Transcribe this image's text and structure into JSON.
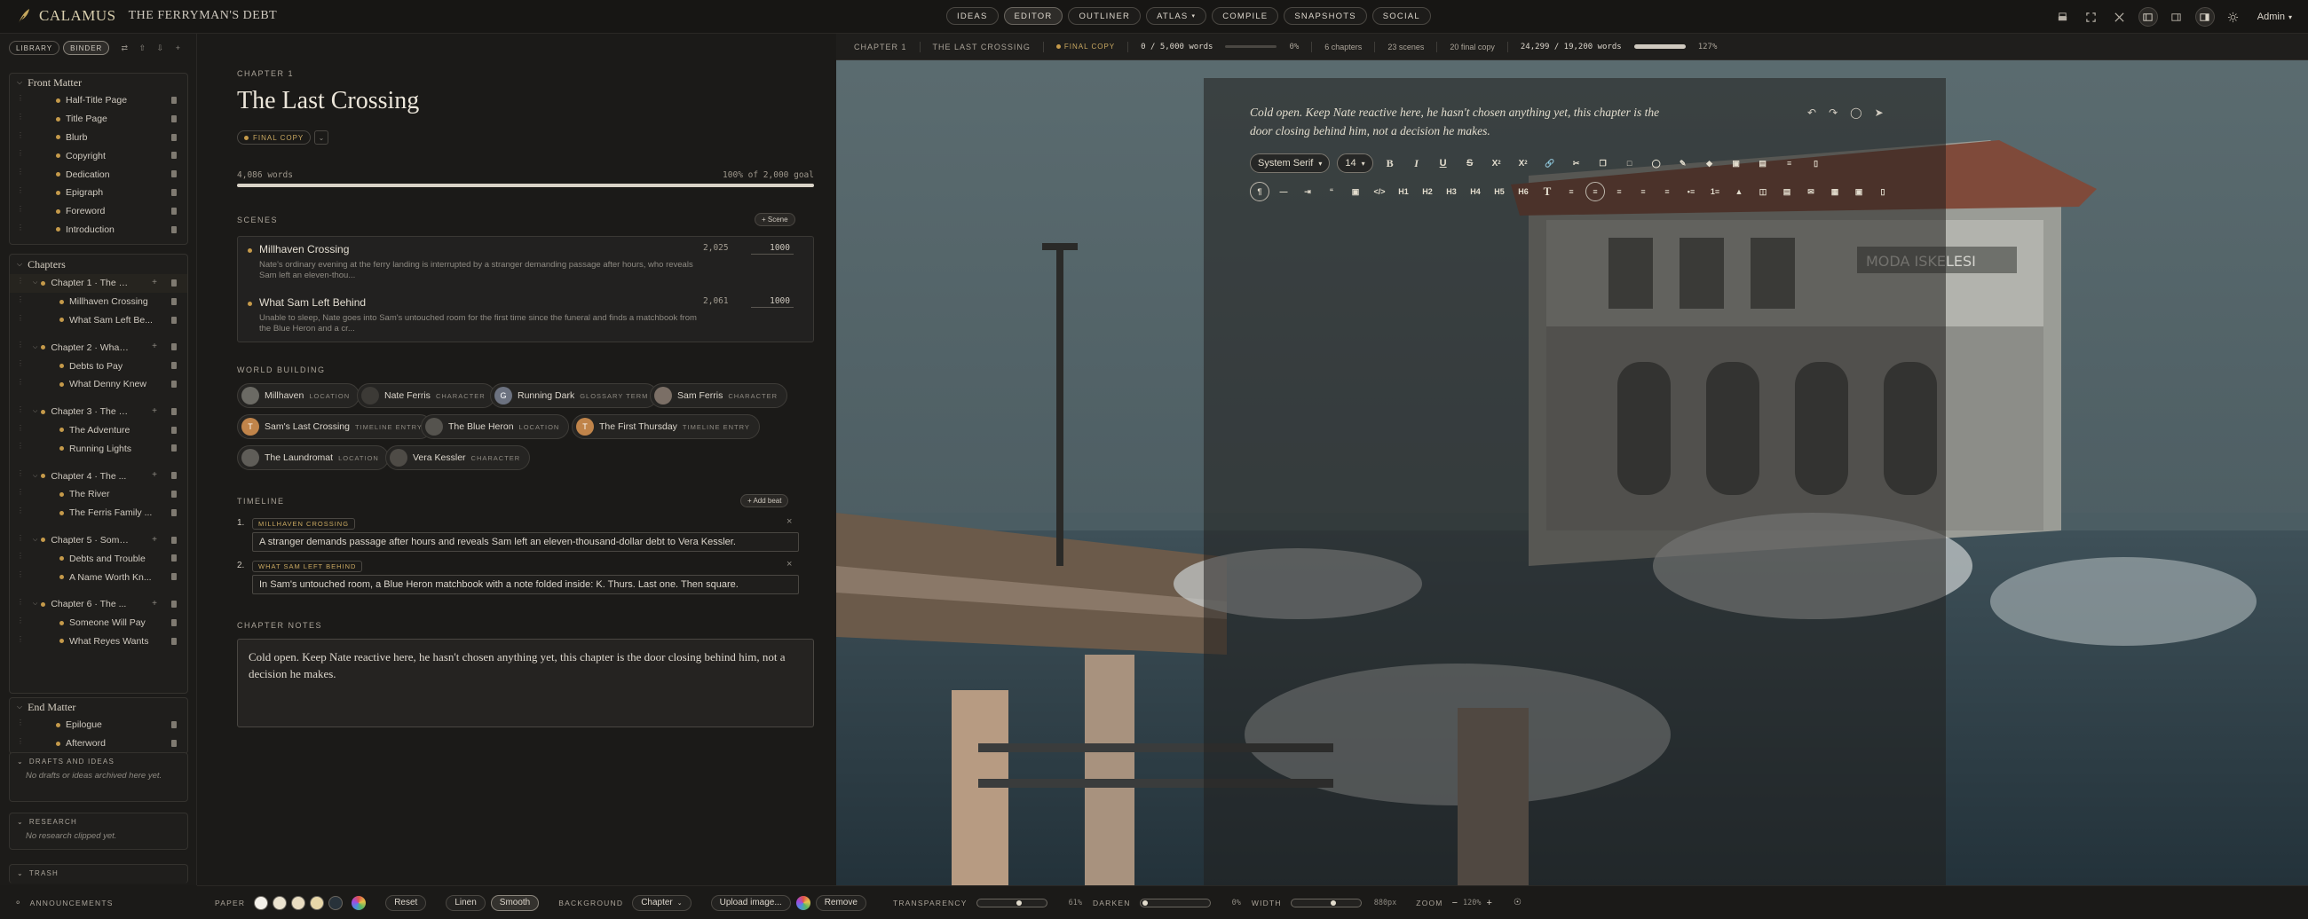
{
  "app": {
    "brand": "CALAMUS",
    "project_title": "THE FERRYMAN'S DEBT"
  },
  "nav": {
    "items": [
      "IDEAS",
      "EDITOR",
      "OUTLINER",
      "ATLAS",
      "COMPILE",
      "SNAPSHOTS",
      "SOCIAL"
    ],
    "active": "EDITOR",
    "user": "Admin"
  },
  "sidebar": {
    "tabs": [
      "LIBRARY",
      "BINDER"
    ],
    "active_tab": "BINDER",
    "front_matter": {
      "title": "Front Matter",
      "items": [
        "Half-Title Page",
        "Title Page",
        "Blurb",
        "Copyright",
        "Dedication",
        "Epigraph",
        "Foreword",
        "Introduction"
      ]
    },
    "chapters": {
      "title": "Chapters",
      "items": [
        {
          "label": "Chapter 1 · The L...",
          "scenes": [
            "Millhaven Crossing",
            "What Sam Left Be..."
          ]
        },
        {
          "label": "Chapter 2 · What...",
          "scenes": [
            "Debts to Pay",
            "What Denny Knew"
          ]
        },
        {
          "label": "Chapter 3 · The F...",
          "scenes": [
            "The Adventure",
            "Running Lights"
          ]
        },
        {
          "label": "Chapter 4 · The ...",
          "scenes": [
            "The River",
            "The Ferris Family ..."
          ]
        },
        {
          "label": "Chapter 5 · Some...",
          "scenes": [
            "Debts and Trouble",
            "A Name Worth Kn..."
          ]
        },
        {
          "label": "Chapter 6 · The ...",
          "scenes": [
            "Someone Will Pay",
            "What Reyes Wants"
          ]
        }
      ]
    },
    "end_matter": {
      "title": "End Matter",
      "items": [
        "Epilogue",
        "Afterword"
      ]
    },
    "drafts": {
      "title": "DRAFTS AND IDEAS",
      "empty": "No drafts or ideas archived here yet."
    },
    "research": {
      "title": "RESEARCH",
      "empty": "No research clipped yet."
    },
    "trash": {
      "title": "TRASH"
    },
    "announcements": "ANNOUNCEMENTS"
  },
  "chapter": {
    "eyebrow": "CHAPTER 1",
    "title": "The Last Crossing",
    "status": "FINAL COPY",
    "word_count": "4,086 words",
    "goal_text": "100% of 2,000 goal",
    "goal_progress": 1.0
  },
  "scenes": {
    "title": "SCENES",
    "add_label": "+ Scene",
    "items": [
      {
        "name": "Millhaven Crossing",
        "desc": "Nate's ordinary evening at the ferry landing is interrupted by a stranger demanding passage after hours, who reveals Sam left an eleven-thou...",
        "words": "2,025",
        "goal": "1000"
      },
      {
        "name": "What Sam Left Behind",
        "desc": "Unable to sleep, Nate goes into Sam's untouched room for the first time since the funeral and finds a matchbook from the Blue Heron and a cr...",
        "words": "2,061",
        "goal": "1000"
      }
    ]
  },
  "world_building": {
    "title": "WORLD BUILDING",
    "items": [
      {
        "name": "Millhaven",
        "type": "LOCATION",
        "initial": "",
        "color": "#6b6a64"
      },
      {
        "name": "Nate Ferris",
        "type": "CHARACTER",
        "initial": "",
        "color": "#3c3a36"
      },
      {
        "name": "Running Dark",
        "type": "GLOSSARY TERM",
        "initial": "G",
        "color": "#6c7280"
      },
      {
        "name": "Sam Ferris",
        "type": "CHARACTER",
        "initial": "",
        "color": "#7b6f66"
      },
      {
        "name": "Sam's Last Crossing",
        "type": "TIMELINE ENTRY",
        "initial": "T",
        "color": "#c0844a"
      },
      {
        "name": "The Blue Heron",
        "type": "LOCATION",
        "initial": "",
        "color": "#55534e"
      },
      {
        "name": "The First Thursday",
        "type": "TIMELINE ENTRY",
        "initial": "T",
        "color": "#c0844a"
      },
      {
        "name": "The Laundromat",
        "type": "LOCATION",
        "initial": "",
        "color": "#5f5d58"
      },
      {
        "name": "Vera Kessler",
        "type": "CHARACTER",
        "initial": "",
        "color": "#4e4b46"
      }
    ]
  },
  "timeline": {
    "title": "TIMELINE",
    "add_label": "+ Add beat",
    "items": [
      {
        "num": "1.",
        "tag": "MILLHAVEN CROSSING",
        "text": "A stranger demands passage after hours and reveals Sam left an eleven-thousand-dollar debt to Vera Kessler."
      },
      {
        "num": "2.",
        "tag": "WHAT SAM LEFT BEHIND",
        "text": "In Sam's untouched room, a Blue Heron matchbook with a note folded inside: K. Thurs. Last one. Then square."
      }
    ]
  },
  "notes": {
    "title": "CHAPTER NOTES",
    "text": "Cold open. Keep Nate reactive here, he hasn't chosen anything yet, this chapter is the door closing behind him, not a decision he makes."
  },
  "editor_bar": {
    "chapter": "CHAPTER 1",
    "scene": "THE LAST CROSSING",
    "status": "FINAL COPY",
    "words": "0 / 5,000 words",
    "words_progress": 0.0,
    "pct": "0%",
    "chapters": "6 chapters",
    "scenes": "23 scenes",
    "final": "20 final copy",
    "total": "24,299 / 19,200 words",
    "total_progress": 1.0,
    "total_pct": "127%"
  },
  "editor": {
    "text": "Cold open. Keep Nate reactive here, he hasn't chosen anything yet, this chapter is the door closing behind him, not a decision he makes.",
    "font": "System Serif",
    "size": "14",
    "headings": [
      "H1",
      "H2",
      "H3",
      "H4",
      "H5",
      "H6"
    ],
    "sub_label": "X",
    "sup_label": "X"
  },
  "bottom": {
    "paper_label": "PAPER",
    "paper_colors": [
      "#f4f1ea",
      "#ebe3d0",
      "#e9ddc2",
      "#e8d7a9",
      "#28323a"
    ],
    "reset": "Reset",
    "linen": "Linen",
    "smooth": "Smooth",
    "background_label": "BACKGROUND",
    "background_value": "Chapter",
    "upload": "Upload image...",
    "remove": "Remove",
    "transparency_label": "TRANSPARENCY",
    "transparency_value": "61%",
    "transparency_level": 0.61,
    "darken_label": "DARKEN",
    "darken_value": "0%",
    "darken_level": 0.0,
    "width_label": "WIDTH",
    "width_value": "880px",
    "width_level": 0.6,
    "zoom_label": "ZOOM",
    "zoom_value": "120%"
  }
}
